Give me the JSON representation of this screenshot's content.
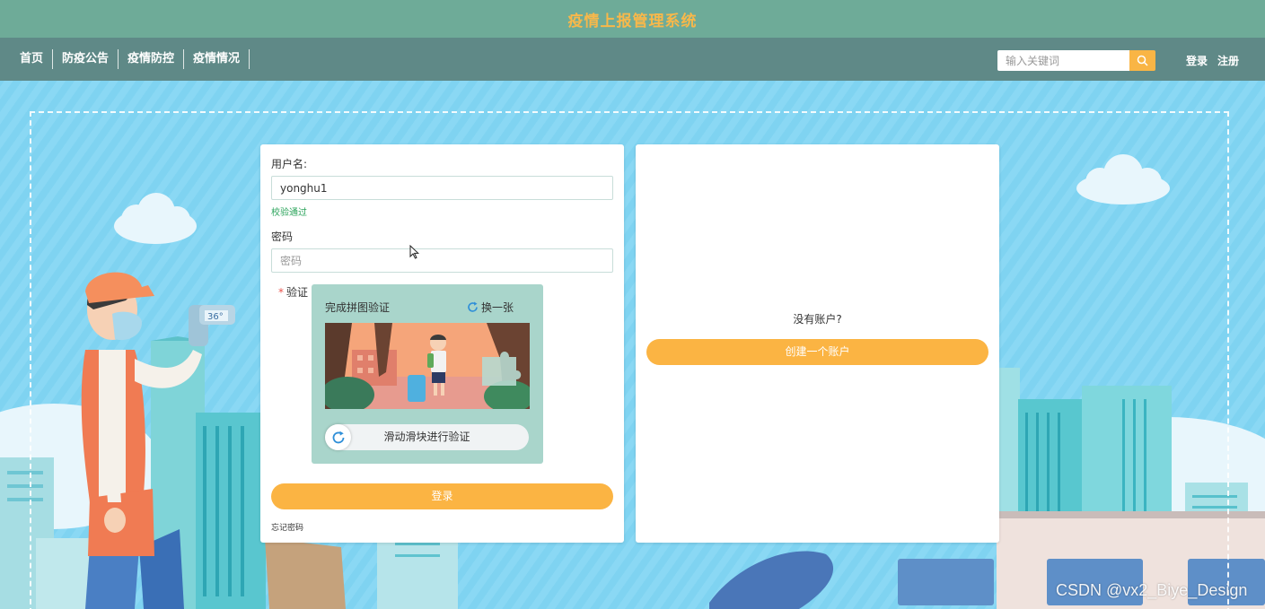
{
  "header": {
    "title": "疫情上报管理系统"
  },
  "nav": {
    "items": [
      {
        "label": "首页"
      },
      {
        "label": "防疫公告"
      },
      {
        "label": "疫情防控"
      },
      {
        "label": "疫情情况"
      }
    ],
    "search": {
      "placeholder": "输入关键词",
      "icon": "search-icon"
    },
    "login_label": "登录",
    "register_label": "注册"
  },
  "login_form": {
    "username_label": "用户名:",
    "username_value": "yonghu1",
    "username_hint": "校验通过",
    "password_label": "密码",
    "password_placeholder": "密码",
    "verify_required_mark": "*",
    "verify_label": "验证",
    "captcha": {
      "title": "完成拼图验证",
      "refresh_label": "换一张",
      "slider_text": "滑动滑块进行验证"
    },
    "submit_label": "登录",
    "forgot_label": "忘记密码"
  },
  "register_panel": {
    "prompt": "没有账户?",
    "create_label": "创建一个账户"
  },
  "watermark": "CSDN @vx2_Biye_Design",
  "colors": {
    "title_bar": "#6eab98",
    "title_text": "#f8b84a",
    "nav_bar": "#5f8987",
    "accent_orange": "#fbb443",
    "hint_green": "#2aa35a",
    "captcha_bg": "#a9d5cb"
  }
}
